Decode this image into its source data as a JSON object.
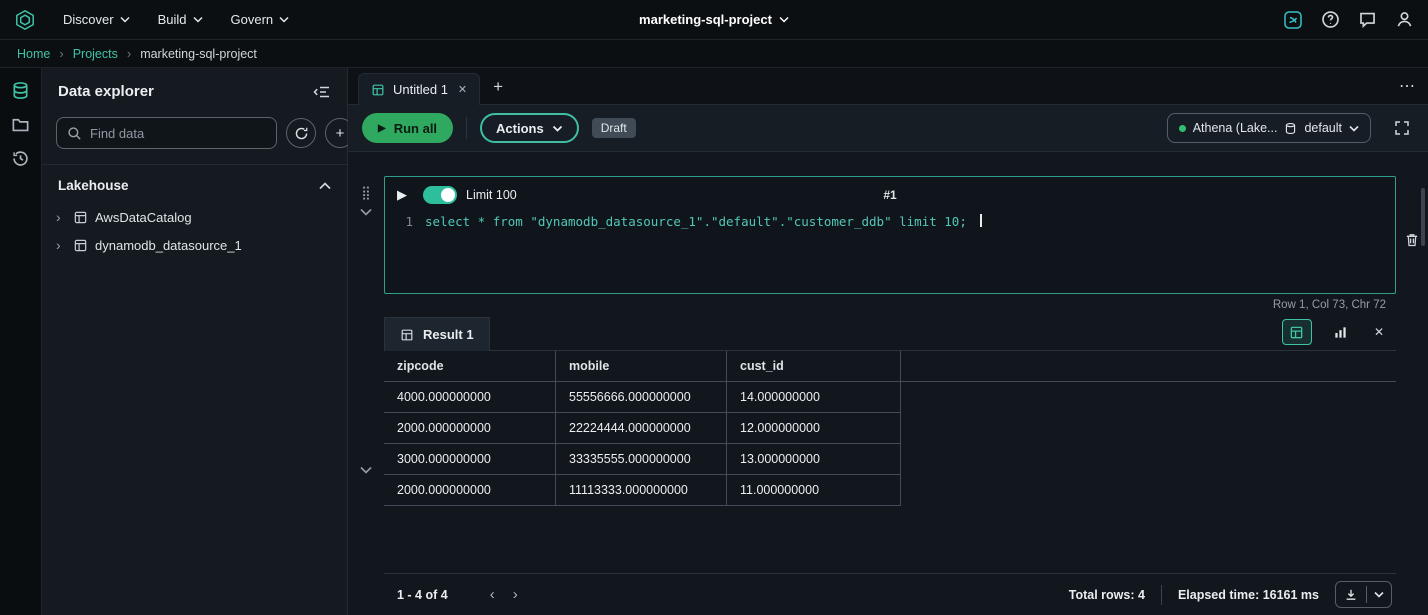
{
  "glyphs": {
    "play": "▶",
    "plus": "+",
    "close": "✕",
    "ellipsis": "⋯",
    "chevron_left": "‹",
    "chevron_right": "›",
    "drag_handle": "⣿"
  },
  "colors": {
    "accent_teal": "#3fc3a6",
    "run_green": "#2fa95f",
    "status_green": "#2fbf71"
  },
  "topnav": {
    "menus": [
      {
        "label": "Discover"
      },
      {
        "label": "Build"
      },
      {
        "label": "Govern"
      }
    ],
    "project_selector": "marketing-sql-project"
  },
  "breadcrumb": {
    "items": [
      "Home",
      "Projects",
      "marketing-sql-project"
    ]
  },
  "explorer": {
    "title": "Data explorer",
    "search_placeholder": "Find data",
    "section_title": "Lakehouse",
    "tree": [
      {
        "label": "AwsDataCatalog"
      },
      {
        "label": "dynamodb_datasource_1"
      }
    ]
  },
  "tabs": {
    "active_label": "Untitled 1"
  },
  "toolbar": {
    "run_all_label": "Run all",
    "actions_label": "Actions",
    "draft_label": "Draft",
    "connection_label": "Athena (Lake...",
    "database_label": "default"
  },
  "cell": {
    "number": "#1",
    "limit_toggle_label": "Limit 100",
    "line_number": "1",
    "code": "select * from \"dynamodb_datasource_1\".\"default\".\"customer_ddb\" limit 10;",
    "caret_status": "Row 1,  Col 73,  Chr 72"
  },
  "results": {
    "tab_label": "Result 1",
    "columns": [
      "zipcode",
      "mobile",
      "cust_id"
    ],
    "rows": [
      [
        "4000.000000000",
        "55556666.000000000",
        "14.000000000"
      ],
      [
        "2000.000000000",
        "22224444.000000000",
        "12.000000000"
      ],
      [
        "3000.000000000",
        "33335555.000000000",
        "13.000000000"
      ],
      [
        "2000.000000000",
        "11113333.000000000",
        "11.000000000"
      ]
    ],
    "pagination_label": "1 - 4 of 4",
    "total_rows_label": "Total rows: 4",
    "elapsed_label": "Elapsed time: 16161 ms"
  }
}
